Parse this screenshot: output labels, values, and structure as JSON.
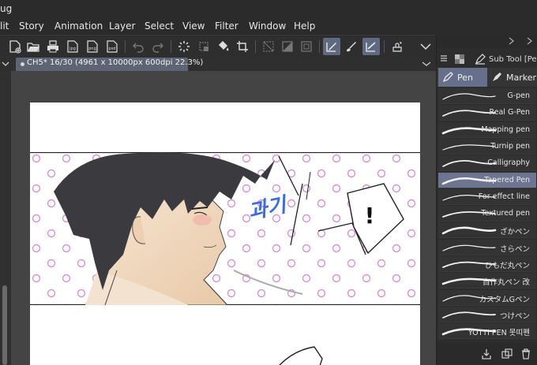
{
  "app": {
    "title_fragment": "ug",
    "menu": [
      "lit",
      "Story",
      "Animation",
      "Layer",
      "Select",
      "View",
      "Filter",
      "Window",
      "Help"
    ]
  },
  "toolbar": {
    "icons": [
      "new-document-icon",
      "open-folder-icon",
      "print-icon",
      "export-jpg-icon",
      "export-png-icon",
      "export-psd-icon",
      "undo-icon",
      "redo-icon",
      "loading-icon",
      "transform-icon",
      "fill-icon",
      "crop-icon",
      "grid-icon",
      "ruler-icon",
      "frame-icon",
      "pen-icon",
      "brush-icon",
      "ruler-line-icon",
      "stamp-icon",
      "chevron-down-icon"
    ],
    "file_badges": [
      "jpg",
      "png",
      "psd"
    ]
  },
  "tab": {
    "title": "CH5* 16/30 (4961 x 10000px 600dpi 22.3%)"
  },
  "panel": {
    "subtool_title": "Sub Tool [Pen",
    "tabs": [
      {
        "label": "Pen",
        "active": true
      },
      {
        "label": "Marker",
        "active": false
      }
    ],
    "brushes": [
      {
        "name": "G-pen",
        "selected": false
      },
      {
        "name": "Real G-Pen",
        "selected": false
      },
      {
        "name": "Mapping pen",
        "selected": false
      },
      {
        "name": "Turnip pen",
        "selected": false
      },
      {
        "name": "Calligraphy",
        "selected": false
      },
      {
        "name": "Tapered Pen",
        "selected": true
      },
      {
        "name": "For effect line",
        "selected": false
      },
      {
        "name": "Textured pen",
        "selected": false
      },
      {
        "name": "ざかペン",
        "selected": false
      },
      {
        "name": "さらペン",
        "selected": false
      },
      {
        "name": "ひもだ丸ペン",
        "selected": false
      },
      {
        "name": "自作丸ペン 改",
        "selected": false
      },
      {
        "name": "カスタムGペン",
        "selected": false
      },
      {
        "name": "つけペン",
        "selected": false
      },
      {
        "name": "YOTTI PEN 못띠펜",
        "selected": false
      }
    ]
  },
  "artwork": {
    "sfx_text": "과기",
    "exclamation": "!"
  },
  "colors": {
    "accent": "#66708a",
    "selected_brush": "#6d7590",
    "dot_pattern": "#e6a6e6"
  }
}
